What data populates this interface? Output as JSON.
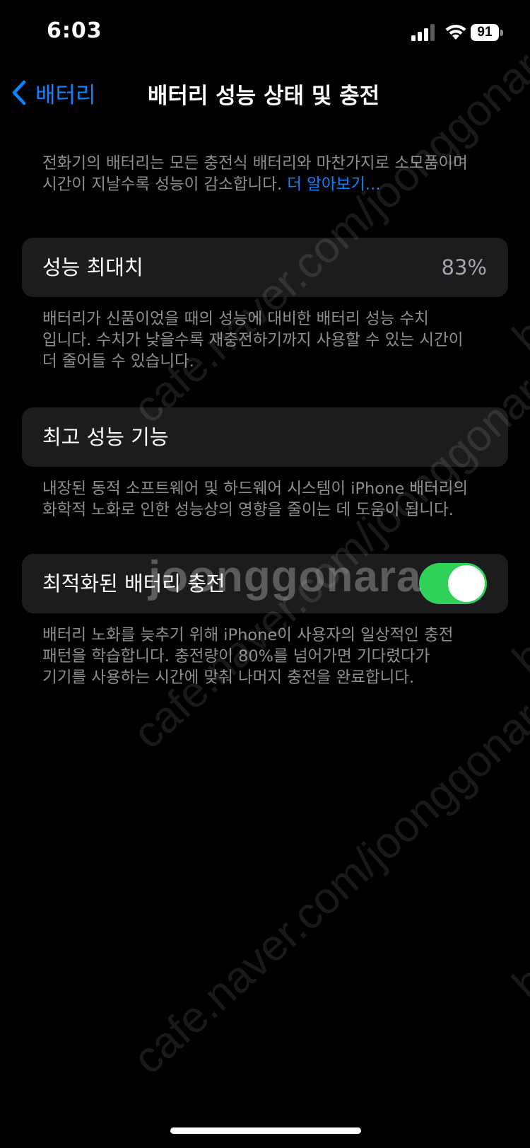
{
  "status_bar": {
    "time": "6:03",
    "battery_level": "91"
  },
  "nav": {
    "back_label": "배터리",
    "title": "배터리 성능 상태 및 충전"
  },
  "intro": {
    "line1": "전화기의 배터리는 모든 충전식 배터리와 마찬가지로 소모품이며",
    "line2": "시간이 지날수록 성능이 감소합니다.",
    "link": "더 알아보기..."
  },
  "max_capacity": {
    "label": "성능 최대치",
    "value": "83%",
    "desc_lines": [
      "배터리가 신품이었을 때의 성능에 대비한 배터리 성능 수치",
      "입니다. 수치가 낮을수록 재충전하기까지 사용할 수 있는 시간이",
      "더 줄어들 수 있습니다."
    ]
  },
  "peak_performance": {
    "label": "최고 성능 기능",
    "desc_lines": [
      "내장된 동적 소프트웨어 및 하드웨어 시스템이 iPhone 배터리의",
      "화학적 노화로 인한 성능상의 영향을 줄이는 데 도움이 됩니다."
    ]
  },
  "optimized_charging": {
    "label": "최적화된 배터리 충전",
    "enabled": true,
    "desc_lines": [
      "배터리 노화를 늦추기 위해 iPhone이 사용자의 일상적인 충전",
      "패턴을 학습합니다. 충전량이 80%를 넘어가면 기다렸다가",
      "기기를 사용하는 시간에 맞춰 나머지 충전을 완료합니다."
    ]
  },
  "watermark": {
    "diagonal": "cafe.naver.com/joonggonara",
    "center": "joonggonara",
    "edge": "bo"
  },
  "colors": {
    "accent": "#0a84ff",
    "toggle_on": "#30d158",
    "card_bg": "#1c1c1e",
    "secondary_text": "#8e8e93"
  }
}
